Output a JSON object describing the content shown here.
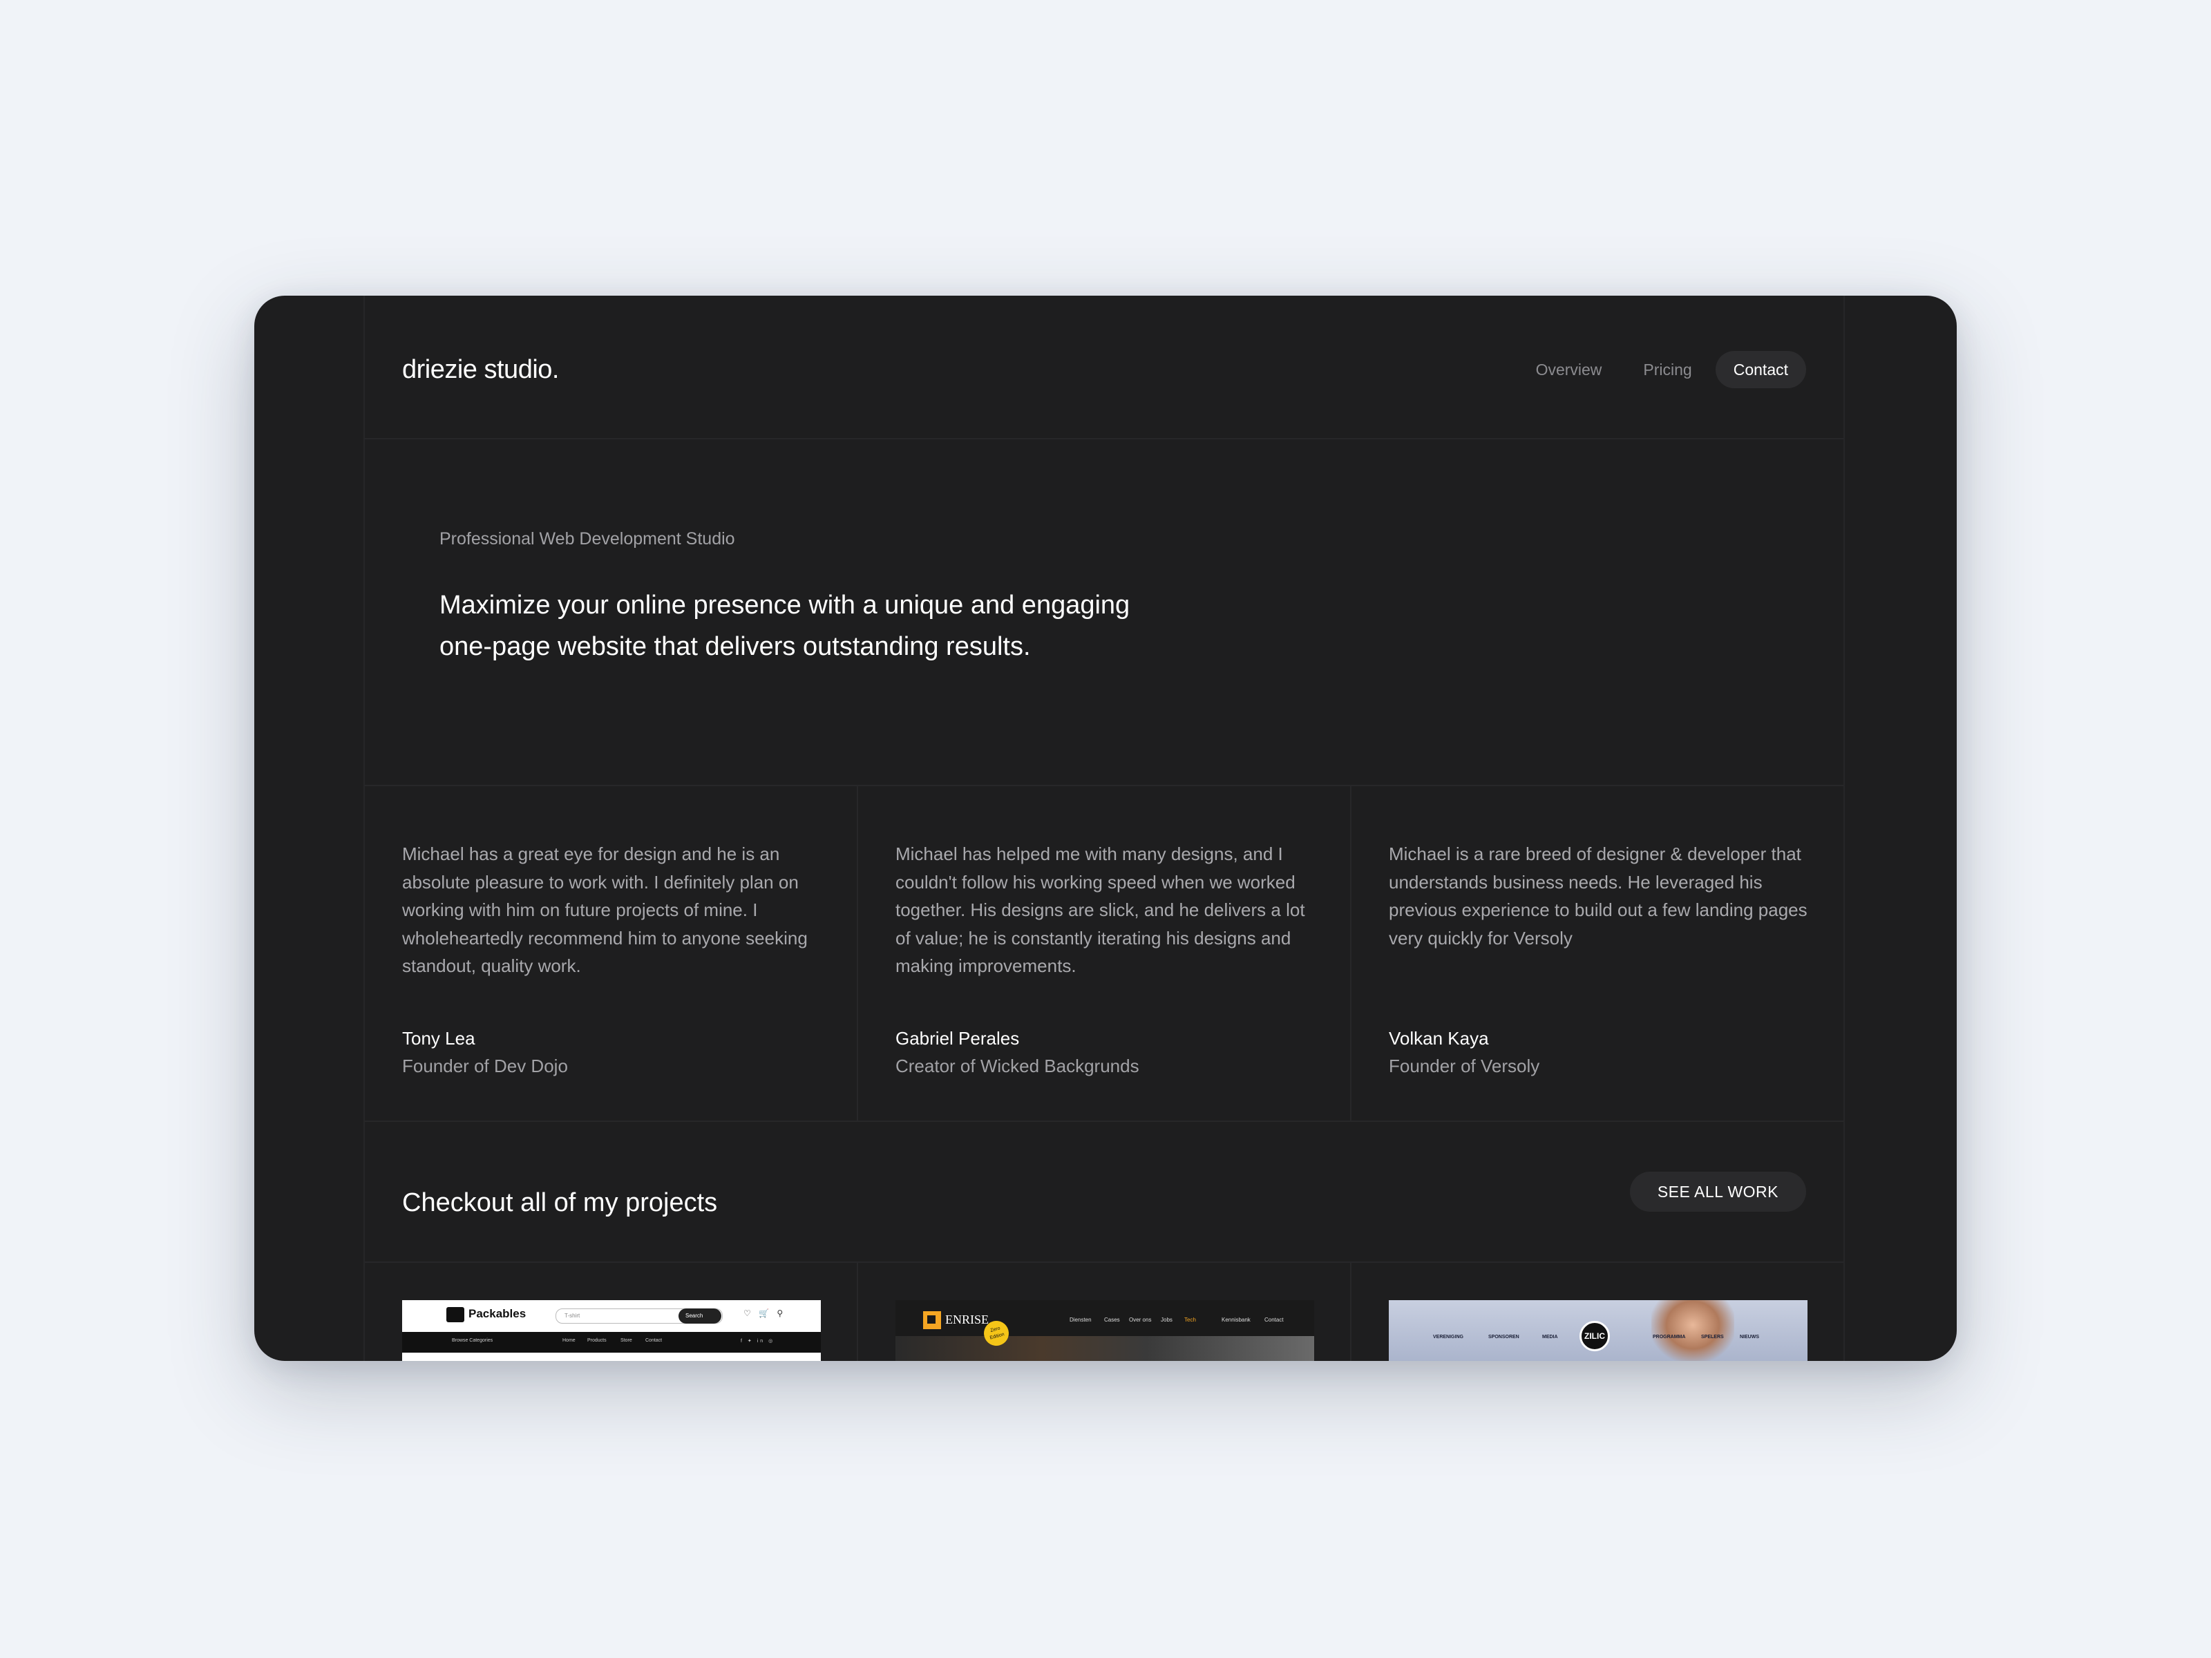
{
  "brand": {
    "logo": "driezie studio."
  },
  "nav": {
    "items": [
      "Overview",
      "Pricing",
      "Contact"
    ],
    "active": "Contact"
  },
  "hero": {
    "subtitle": "Professional Web Development Studio",
    "title": "Maximize your online presence with a unique and engaging one-page website that delivers outstanding results."
  },
  "testimonials": [
    {
      "quote": "Michael has a great eye for design and he is an absolute pleasure to work with. I definitely plan on working with him on future projects of mine. I wholeheartedly recommend him to anyone seeking standout, quality work.",
      "author": "Tony Lea",
      "role": "Founder of Dev Dojo"
    },
    {
      "quote": "Michael has helped me with many designs, and I couldn't follow his working speed when we worked together. His designs are slick, and he delivers a lot of value; he is constantly iterating his designs and making improvements.",
      "author": "Gabriel Perales",
      "role": "Creator of Wicked Backgrunds"
    },
    {
      "quote": "Michael is a rare breed of designer & developer that understands business needs. He leveraged his previous experience to build out a few landing pages very quickly for Versoly",
      "author": "Volkan Kaya",
      "role": "Founder of Versoly"
    }
  ],
  "projects": {
    "title": "Checkout all of my projects",
    "see_all_label": "SEE ALL WORK",
    "items": [
      {
        "name": "Packables",
        "search_placeholder": "T-shirt",
        "search_button": "Search",
        "icons": "♡ 🛒 ⚲",
        "nav": [
          "Browse Categories",
          "Home",
          "Products",
          "Store",
          "Contact"
        ],
        "social": "f ✦ in ◎"
      },
      {
        "name": "ENRISE",
        "badge": "Zero Edition",
        "nav": [
          "Diensten",
          "Cases",
          "Over ons",
          "Jobs",
          "Tech",
          "Kennisbank",
          "Contact"
        ]
      },
      {
        "name": "ZILIC",
        "nav": [
          "VERENIGING",
          "SPONSOREN",
          "MEDIA",
          "PROGRAMMA",
          "SPELERS",
          "NIEUWS"
        ]
      }
    ]
  },
  "colors": {
    "page_bg": "#f0f3f8",
    "window_bg": "#1e1e1f",
    "text_primary": "#ffffff",
    "text_muted": "#a9a9ad",
    "button_bg": "#2a2a2c",
    "enrise_accent": "#f5a623"
  }
}
